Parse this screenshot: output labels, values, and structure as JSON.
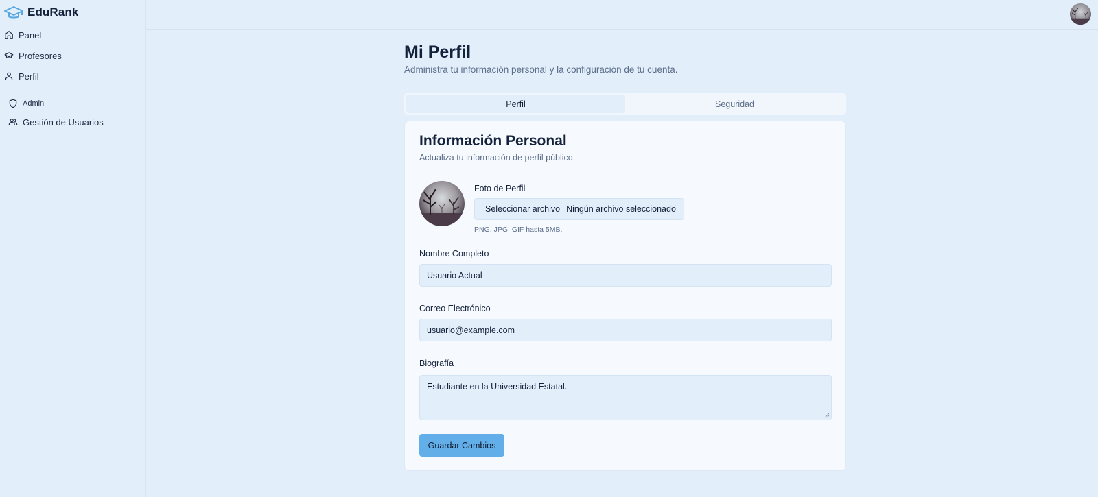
{
  "brand": {
    "name": "EduRank"
  },
  "sidebar": {
    "items": [
      {
        "label": "Panel",
        "icon": "home-icon"
      },
      {
        "label": "Profesores",
        "icon": "graduation-cap-icon"
      },
      {
        "label": "Perfil",
        "icon": "user-icon"
      }
    ],
    "section": {
      "label": "Admin",
      "icon": "shield-icon"
    },
    "admin_items": [
      {
        "label": "Gestión de Usuarios",
        "icon": "users-icon"
      }
    ]
  },
  "header": {
    "avatar": "user-avatar"
  },
  "main": {
    "title": "Mi Perfil",
    "subtitle": "Administra tu información personal y la configuración de tu cuenta.",
    "tabs": [
      {
        "label": "Perfil",
        "active": true
      },
      {
        "label": "Seguridad",
        "active": false
      }
    ],
    "card": {
      "title": "Información Personal",
      "subtitle": "Actualiza tu información de perfil público.",
      "photo": {
        "label": "Foto de Perfil",
        "button_label": "Seleccionar archivo",
        "status": "Ningún archivo seleccionado",
        "hint": "PNG, JPG, GIF hasta 5MB."
      },
      "fields": {
        "name": {
          "label": "Nombre Completo",
          "value": "Usuario Actual"
        },
        "email": {
          "label": "Correo Electrónico",
          "value": "usuario@example.com"
        },
        "bio": {
          "label": "Biografía",
          "value": "Estudiante en la Universidad Estatal."
        }
      },
      "save_label": "Guardar Cambios"
    }
  },
  "colors": {
    "background": "#e2effb",
    "card": "#f6fafe",
    "accent": "#62aee9",
    "brand_icon": "#5aa6e0"
  }
}
